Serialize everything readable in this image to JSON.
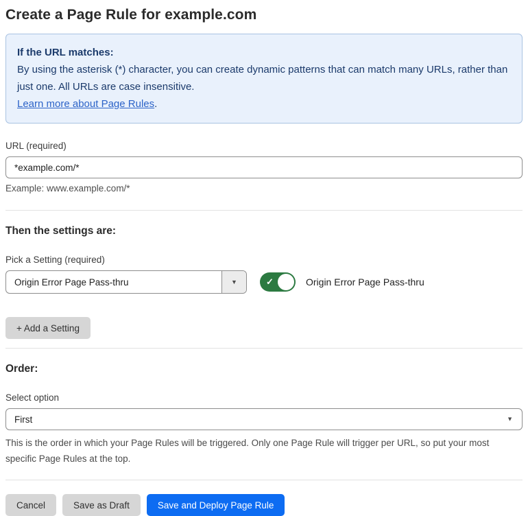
{
  "page": {
    "title": "Create a Page Rule for example.com"
  },
  "info_box": {
    "heading": "If the URL matches:",
    "body": "By using the asterisk (*) character, you can create dynamic patterns that can match many URLs, rather than just one. All URLs are case insensitive.",
    "link_text": "Learn more about Page Rules",
    "link_suffix": "."
  },
  "url_field": {
    "label": "URL (required)",
    "value": "*example.com/*",
    "helper": "Example: www.example.com/*"
  },
  "settings_section": {
    "heading": "Then the settings are:",
    "picker_label": "Pick a Setting (required)",
    "picker_value": "Origin Error Page Pass-thru",
    "toggle_label": "Origin Error Page Pass-thru",
    "toggle_state": "on",
    "add_button_label": "+ Add a Setting"
  },
  "order_section": {
    "heading": "Order:",
    "select_label": "Select option",
    "select_value": "First",
    "helper": "This is the order in which your Page Rules will be triggered. Only one Page Rule will trigger per URL, so put your most specific Page Rules at the top."
  },
  "footer": {
    "cancel_label": "Cancel",
    "save_draft_label": "Save as Draft",
    "save_deploy_label": "Save and Deploy Page Rule"
  },
  "icons": {
    "caret_down": "▼",
    "check": "✓"
  },
  "colors": {
    "accent_blue": "#0d6cf2",
    "toggle_green": "#2c7a41",
    "info_bg": "#e9f1fc",
    "info_border": "#a9c3e2",
    "info_text": "#1b3a6b",
    "link_blue": "#2c63c8"
  }
}
